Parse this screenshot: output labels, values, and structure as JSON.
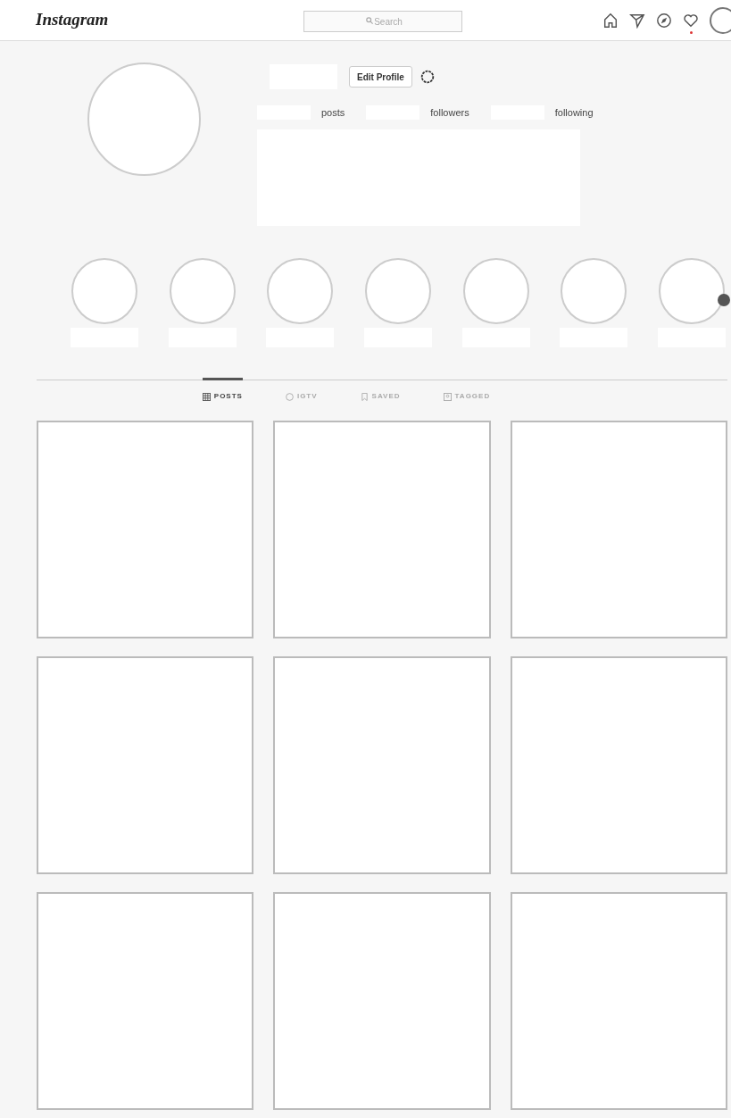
{
  "header": {
    "logo": "Instagram",
    "search": {
      "placeholder": "Search"
    },
    "activity_notification": true
  },
  "profile": {
    "edit_button": "Edit Profile",
    "stats": [
      {
        "label": "posts"
      },
      {
        "label": "followers"
      },
      {
        "label": "following"
      }
    ]
  },
  "tabs": [
    {
      "label": "POSTS",
      "selected": true
    },
    {
      "label": "IGTV",
      "selected": false
    },
    {
      "label": "SAVED",
      "selected": false
    },
    {
      "label": "TAGGED",
      "selected": false
    }
  ]
}
